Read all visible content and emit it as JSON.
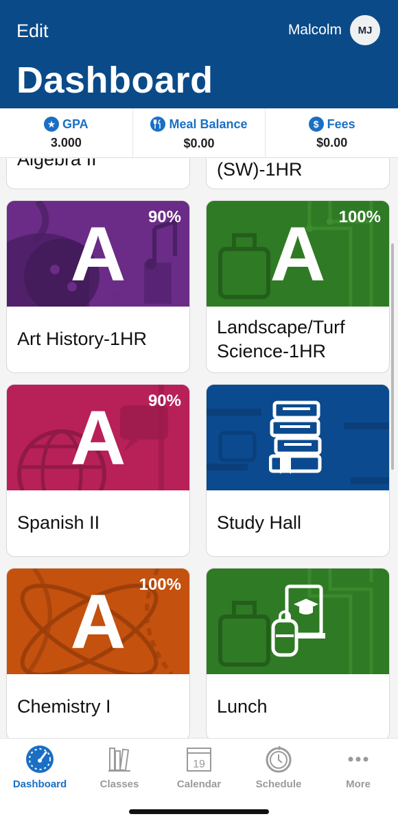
{
  "header": {
    "edit_label": "Edit",
    "user_name": "Malcolm",
    "avatar_initials": "MJ",
    "title": "Dashboard"
  },
  "stats": [
    {
      "icon": "star-icon",
      "label": "GPA",
      "value": "3.000"
    },
    {
      "icon": "utensils-icon",
      "label": "Meal Balance",
      "value": "$0.00"
    },
    {
      "icon": "dollar-icon",
      "label": "Fees",
      "value": "$0.00"
    }
  ],
  "partial_cards": [
    {
      "title": "Algebra II"
    },
    {
      "title": "(SW)-1HR"
    }
  ],
  "courses": [
    {
      "title": "Art History-1HR",
      "grade": "A",
      "percent": "90%",
      "color": "#6a2c86"
    },
    {
      "title": "Landscape/Turf Science-1HR",
      "grade": "A",
      "percent": "100%",
      "color": "#2f7a24"
    },
    {
      "title": "Spanish II",
      "grade": "A",
      "percent": "90%",
      "color": "#b82058"
    },
    {
      "title": "Study Hall",
      "icon": "books-icon",
      "color": "#0b4a8f"
    },
    {
      "title": "Chemistry I",
      "grade": "A",
      "percent": "100%",
      "color": "#c4510e"
    },
    {
      "title": "Lunch",
      "icon": "backpack-icon",
      "color": "#2f7a24"
    }
  ],
  "tabs": [
    {
      "label": "Dashboard",
      "icon": "gauge-icon",
      "active": true
    },
    {
      "label": "Classes",
      "icon": "books-icon"
    },
    {
      "label": "Calendar",
      "icon": "calendar-icon",
      "calendar_day": "19"
    },
    {
      "label": "Schedule",
      "icon": "clock-icon"
    },
    {
      "label": "More",
      "icon": "more-icon"
    }
  ],
  "colors": {
    "header_bg": "#0b4a88",
    "accent": "#1a6fc4"
  }
}
